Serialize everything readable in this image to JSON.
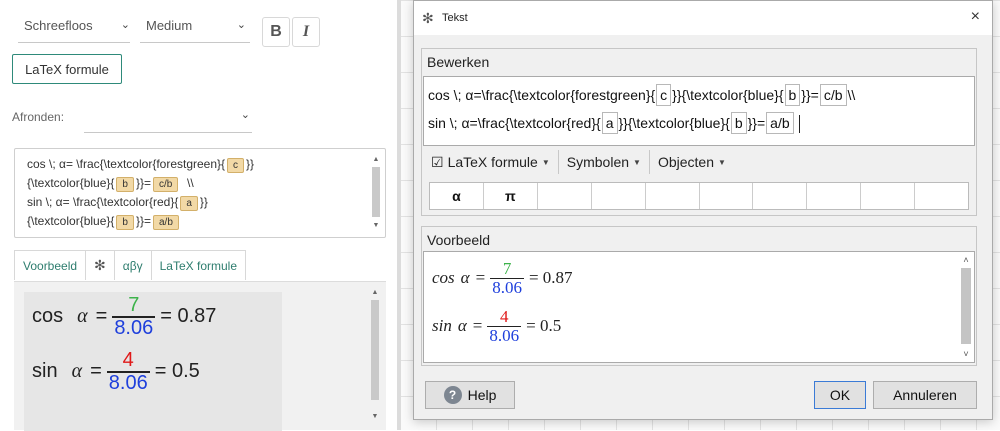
{
  "left": {
    "font_family_select": "Schreefloos",
    "font_size_select": "Medium",
    "bold_label": "B",
    "italic_label": "I",
    "latex_chip_label": "LaTeX formule",
    "afronden_label": "Afronden:",
    "editor": {
      "line1_prefix": "cos \\; α= \\frac{\\textcolor{forestgreen}{",
      "chip_c": "c",
      "line1_suffix": "}}",
      "line2_prefix": "{\\textcolor{blue}{",
      "chip_b": "b",
      "line2_mid": "}}=",
      "chip_cb": "c/b",
      "line2_suffix": "\\\\",
      "line3_prefix": "sin \\; α= \\frac{\\textcolor{red}{",
      "chip_a": "a",
      "line3_suffix": "}}",
      "line4_prefix": "{\\textcolor{blue}{",
      "line4_mid": "}}=",
      "chip_ab": "a/b"
    },
    "tabs": [
      "Voorbeeld",
      "αβγ",
      "LaTeX formule"
    ],
    "preview": {
      "cos_word": "cos",
      "sin_word": "sin",
      "alpha": "α",
      "equals": "=",
      "cos_num": "7",
      "cos_den": "8.06",
      "cos_result": "= 0.87",
      "sin_num": "4",
      "sin_den": "8.06",
      "sin_result": "= 0.5"
    }
  },
  "dialog": {
    "title": "Tekst",
    "close": "×",
    "bewerken_legend": "Bewerken",
    "code_line1": {
      "p1": "cos \\; α=\\frac{\\textcolor{forestgreen}{",
      "v1": "c",
      "p2": "}}{\\textcolor{blue}{",
      "v2": "b",
      "p3": "}}=",
      "v3": "c/b",
      "p4": "\\\\"
    },
    "code_line2": {
      "p1": "sin \\; α=\\frac{\\textcolor{red}{",
      "v1": "a",
      "p2": "}}{\\textcolor{blue}{",
      "v2": "b",
      "p3": "}}=",
      "v3": "a/b"
    },
    "toolbar": {
      "latex_check": "☑",
      "latex_label": "LaTeX formule",
      "symbols_label": "Symbolen",
      "objects_label": "Objecten"
    },
    "symbols": [
      "α",
      "π",
      "",
      "",
      "",
      "",
      "",
      "",
      "",
      ""
    ],
    "voorbeeld_legend": "Voorbeeld",
    "preview": {
      "cos_word": "cos",
      "sin_word": "sin",
      "alpha": "α",
      "equals": "=",
      "cos_num": "7",
      "cos_den": "8.06",
      "cos_result": "= 0.87",
      "sin_num": "4",
      "sin_den": "8.06",
      "sin_result": "= 0.5"
    },
    "help_label": "Help",
    "ok_label": "OK",
    "cancel_label": "Annuleren"
  },
  "colors": {
    "green": "#3cb34a",
    "blue": "#1e3fdc",
    "red": "#e01919",
    "accent": "#2e8a7a"
  }
}
